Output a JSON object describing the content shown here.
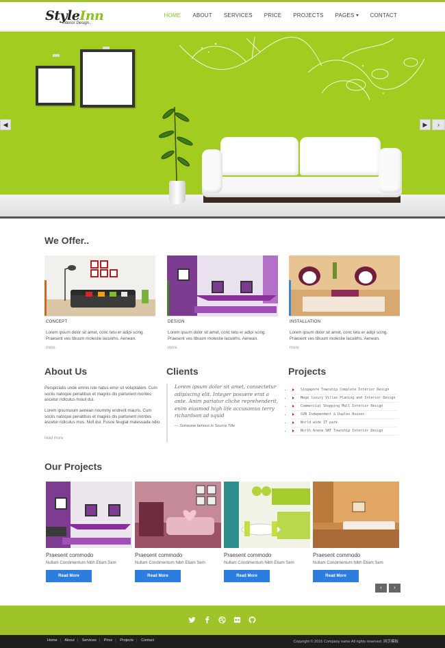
{
  "brand": {
    "logo_main_a": "Style",
    "logo_main_b": "Inn",
    "logo_sub": "Interior Design.."
  },
  "nav": {
    "items": [
      "HOME",
      "ABOUT",
      "SERVICES",
      "PRICE",
      "PROJECTS",
      "PAGES",
      "CONTACT"
    ],
    "active": "HOME"
  },
  "hero": {
    "prev_icon": "◀",
    "next_icon": "▶"
  },
  "offer": {
    "title": "We Offer..",
    "cards": [
      {
        "label": "CONCEPT",
        "text": "Lorem ipsum dolor sit amet, conc tetu er adipi scing. Praesent ves tibuum molestie lacuiirhs. Aenean.",
        "more": "more"
      },
      {
        "label": "DESIGN",
        "text": "Lorem ipsum dolor sit amet, conc tetu er adipi scing. Praesent ves tibuum molestie lacuiirhs. Aenean.",
        "more": "more"
      },
      {
        "label": "INSTALLATION",
        "text": "Lorem ipsum dolor sit amet, conc tetu er adipi scing. Praesent ves tibuum molestie lacuiirhs. Aenean.",
        "more": "more"
      }
    ]
  },
  "about": {
    "title": "About Us",
    "p1": "Perspiciatis unde omnis iste natus error sit voluptatem. Cum sociis natoque penatibus et magnis dis parturient montes ascetur ridiculus mouil dui.",
    "p2": "Lorem ipsumuium aenean noummy endrerit mauris. Cum sociis natoque penatibus et magnis dis parturient montes ascetur ridiculus mus. Null dui. Fusce feugiat malesuada odio.",
    "more": "read more"
  },
  "clients": {
    "title": "Clients",
    "quote": "Lorem ipsum dolor sit amet, consectetur adipiscing elit. Integer posuere erat a ante. Anim pariatur cliche reprehenderit, enim eiusmod high life accusamus terry richardson ad squid",
    "source": "— Someone famous in Source Title"
  },
  "projects_list": {
    "title": "Projects",
    "items": [
      "Singapore Township Complete Interior Design",
      "Mega luxury Villas Planing and Interior Design",
      "Commercial Shopping Mall Interior Design",
      "SVN Independent & Duplex Houses",
      "World wide IT park",
      "North Arena SNT Township Interior Design"
    ]
  },
  "our_projects": {
    "title": "Our Projects",
    "cards": [
      {
        "title": "Praesent commodo",
        "sub": "Nullam Condimentum Nibh Etiam Sem",
        "button": "Read More"
      },
      {
        "title": "Praesent commodo",
        "sub": "Nullam Condimentum Nibh Etiam Sem",
        "button": "Read More"
      },
      {
        "title": "Praesent commodo",
        "sub": "Nullam Condimentum Nibh Etiam Sem",
        "button": "Read More"
      },
      {
        "title": "Praesent commodo",
        "sub": "Nullam Condimentum Nibh Etiam Sem",
        "button": "Read More"
      }
    ],
    "prev": "‹",
    "next": "›"
  },
  "footer": {
    "social": [
      "twitter-icon",
      "facebook-icon",
      "dribbble-icon",
      "flickr-icon",
      "github-icon"
    ],
    "links": [
      "Home",
      "About",
      "Services",
      "Price",
      "Projects",
      "Contact"
    ],
    "copyright": "Copyright © 2016 Company name All rights reserved.",
    "badge": "网页模板"
  },
  "colors": {
    "accent": "#9ec42a",
    "button": "#2b7de0",
    "footer_dark": "#1f1f1f"
  }
}
